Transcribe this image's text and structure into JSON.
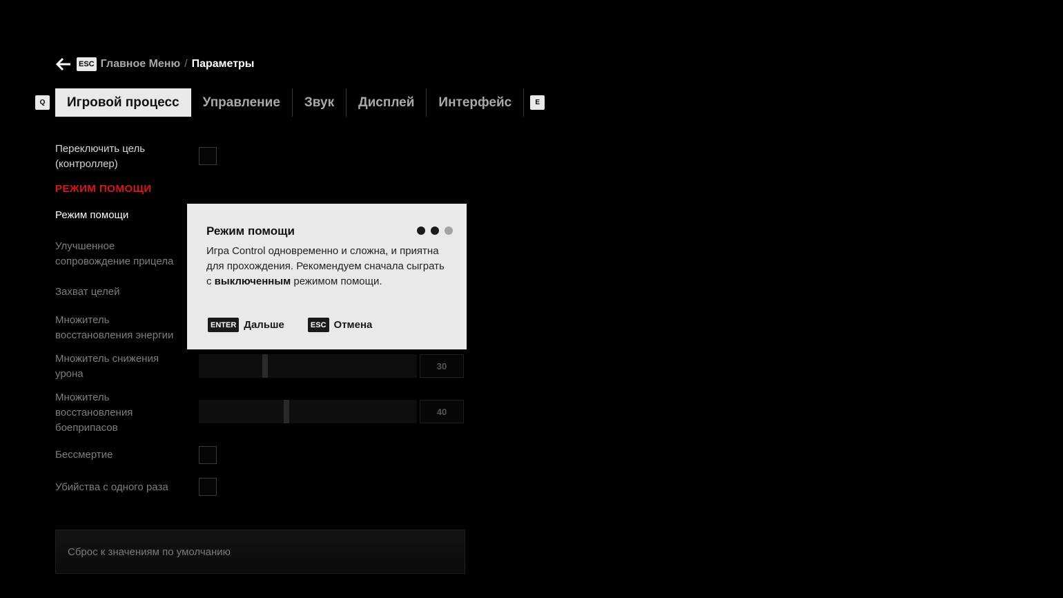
{
  "breadcrumb": {
    "back_key": "ESC",
    "previous": "Главное Меню",
    "separator": "/",
    "current": "Параметры"
  },
  "tabs": {
    "prev_key": "Q",
    "next_key": "E",
    "items": [
      {
        "label": "Игровой процесс",
        "active": true
      },
      {
        "label": "Управление",
        "active": false
      },
      {
        "label": "Звук",
        "active": false
      },
      {
        "label": "Дисплей",
        "active": false
      },
      {
        "label": "Интерфейс",
        "active": false
      }
    ]
  },
  "settings": {
    "switch_target": "Переключить цель (контроллер)",
    "section_header": "РЕЖИМ ПОМОЩИ",
    "assist_mode": "Режим помощи",
    "aim_assist": "Улучшенное сопровождение прицела",
    "target_lock": "Захват целей",
    "energy_regen": "Множитель восстановления энергии",
    "damage_reduction": {
      "label": "Множитель снижения урона",
      "value": "30",
      "fraction": 0.3
    },
    "ammo_regen": {
      "label": "Множитель восстановления боеприпасов",
      "value": "40",
      "fraction": 0.4
    },
    "immortality": "Бессмертие",
    "one_hit_kills": "Убийства с одного раза",
    "reset_label": "Сброс к значениям по умолчанию"
  },
  "modal": {
    "title": "Режим помощи",
    "pages_total": 3,
    "pages_filled": 2,
    "body_before": "Игра Control одновременно и сложна, и приятна для прохождения. Рекомендуем сначала сыграть с ",
    "body_bold": "выключенным",
    "body_after": " режимом помощи.",
    "next_key": "ENTER",
    "next_label": "Дальше",
    "cancel_key": "ESC",
    "cancel_label": "Отмена"
  },
  "colors": {
    "accent_red": "#d8171b",
    "panel_light": "#e9e9e7",
    "background": "#000000"
  }
}
